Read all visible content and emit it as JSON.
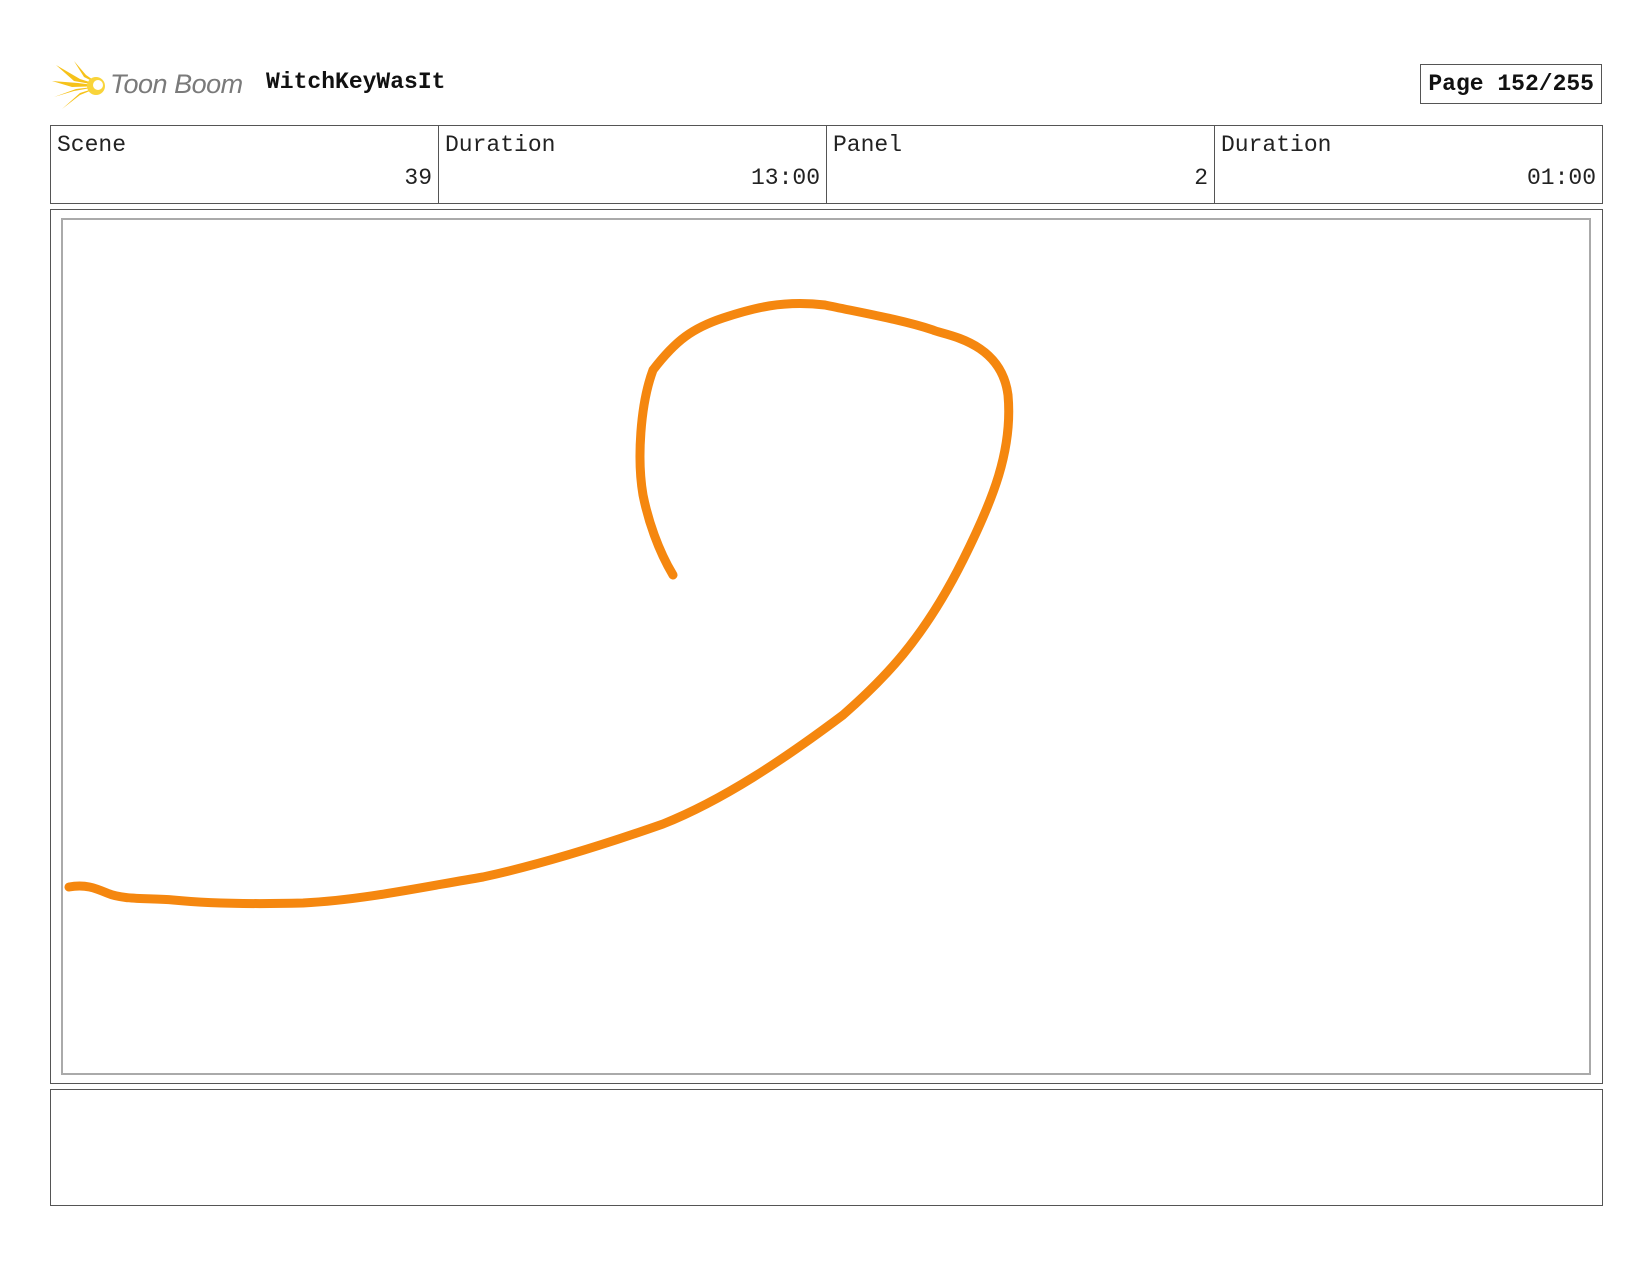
{
  "header": {
    "logo_text": "Toon Boom",
    "project_title": "WitchKeyWasIt",
    "page_label": "Page 152/255"
  },
  "info": {
    "scene_label": "Scene",
    "scene_value": "39",
    "scene_duration_label": "Duration",
    "scene_duration_value": "13:00",
    "panel_label": "Panel",
    "panel_value": "2",
    "panel_duration_label": "Duration",
    "panel_duration_value": "01:00"
  },
  "panel": {
    "stroke_color": "#f5870f"
  },
  "notes": {
    "text": ""
  },
  "colors": {
    "logo_star": "#f6c21a",
    "logo_text": "#7a7a7a",
    "border": "#555555"
  }
}
